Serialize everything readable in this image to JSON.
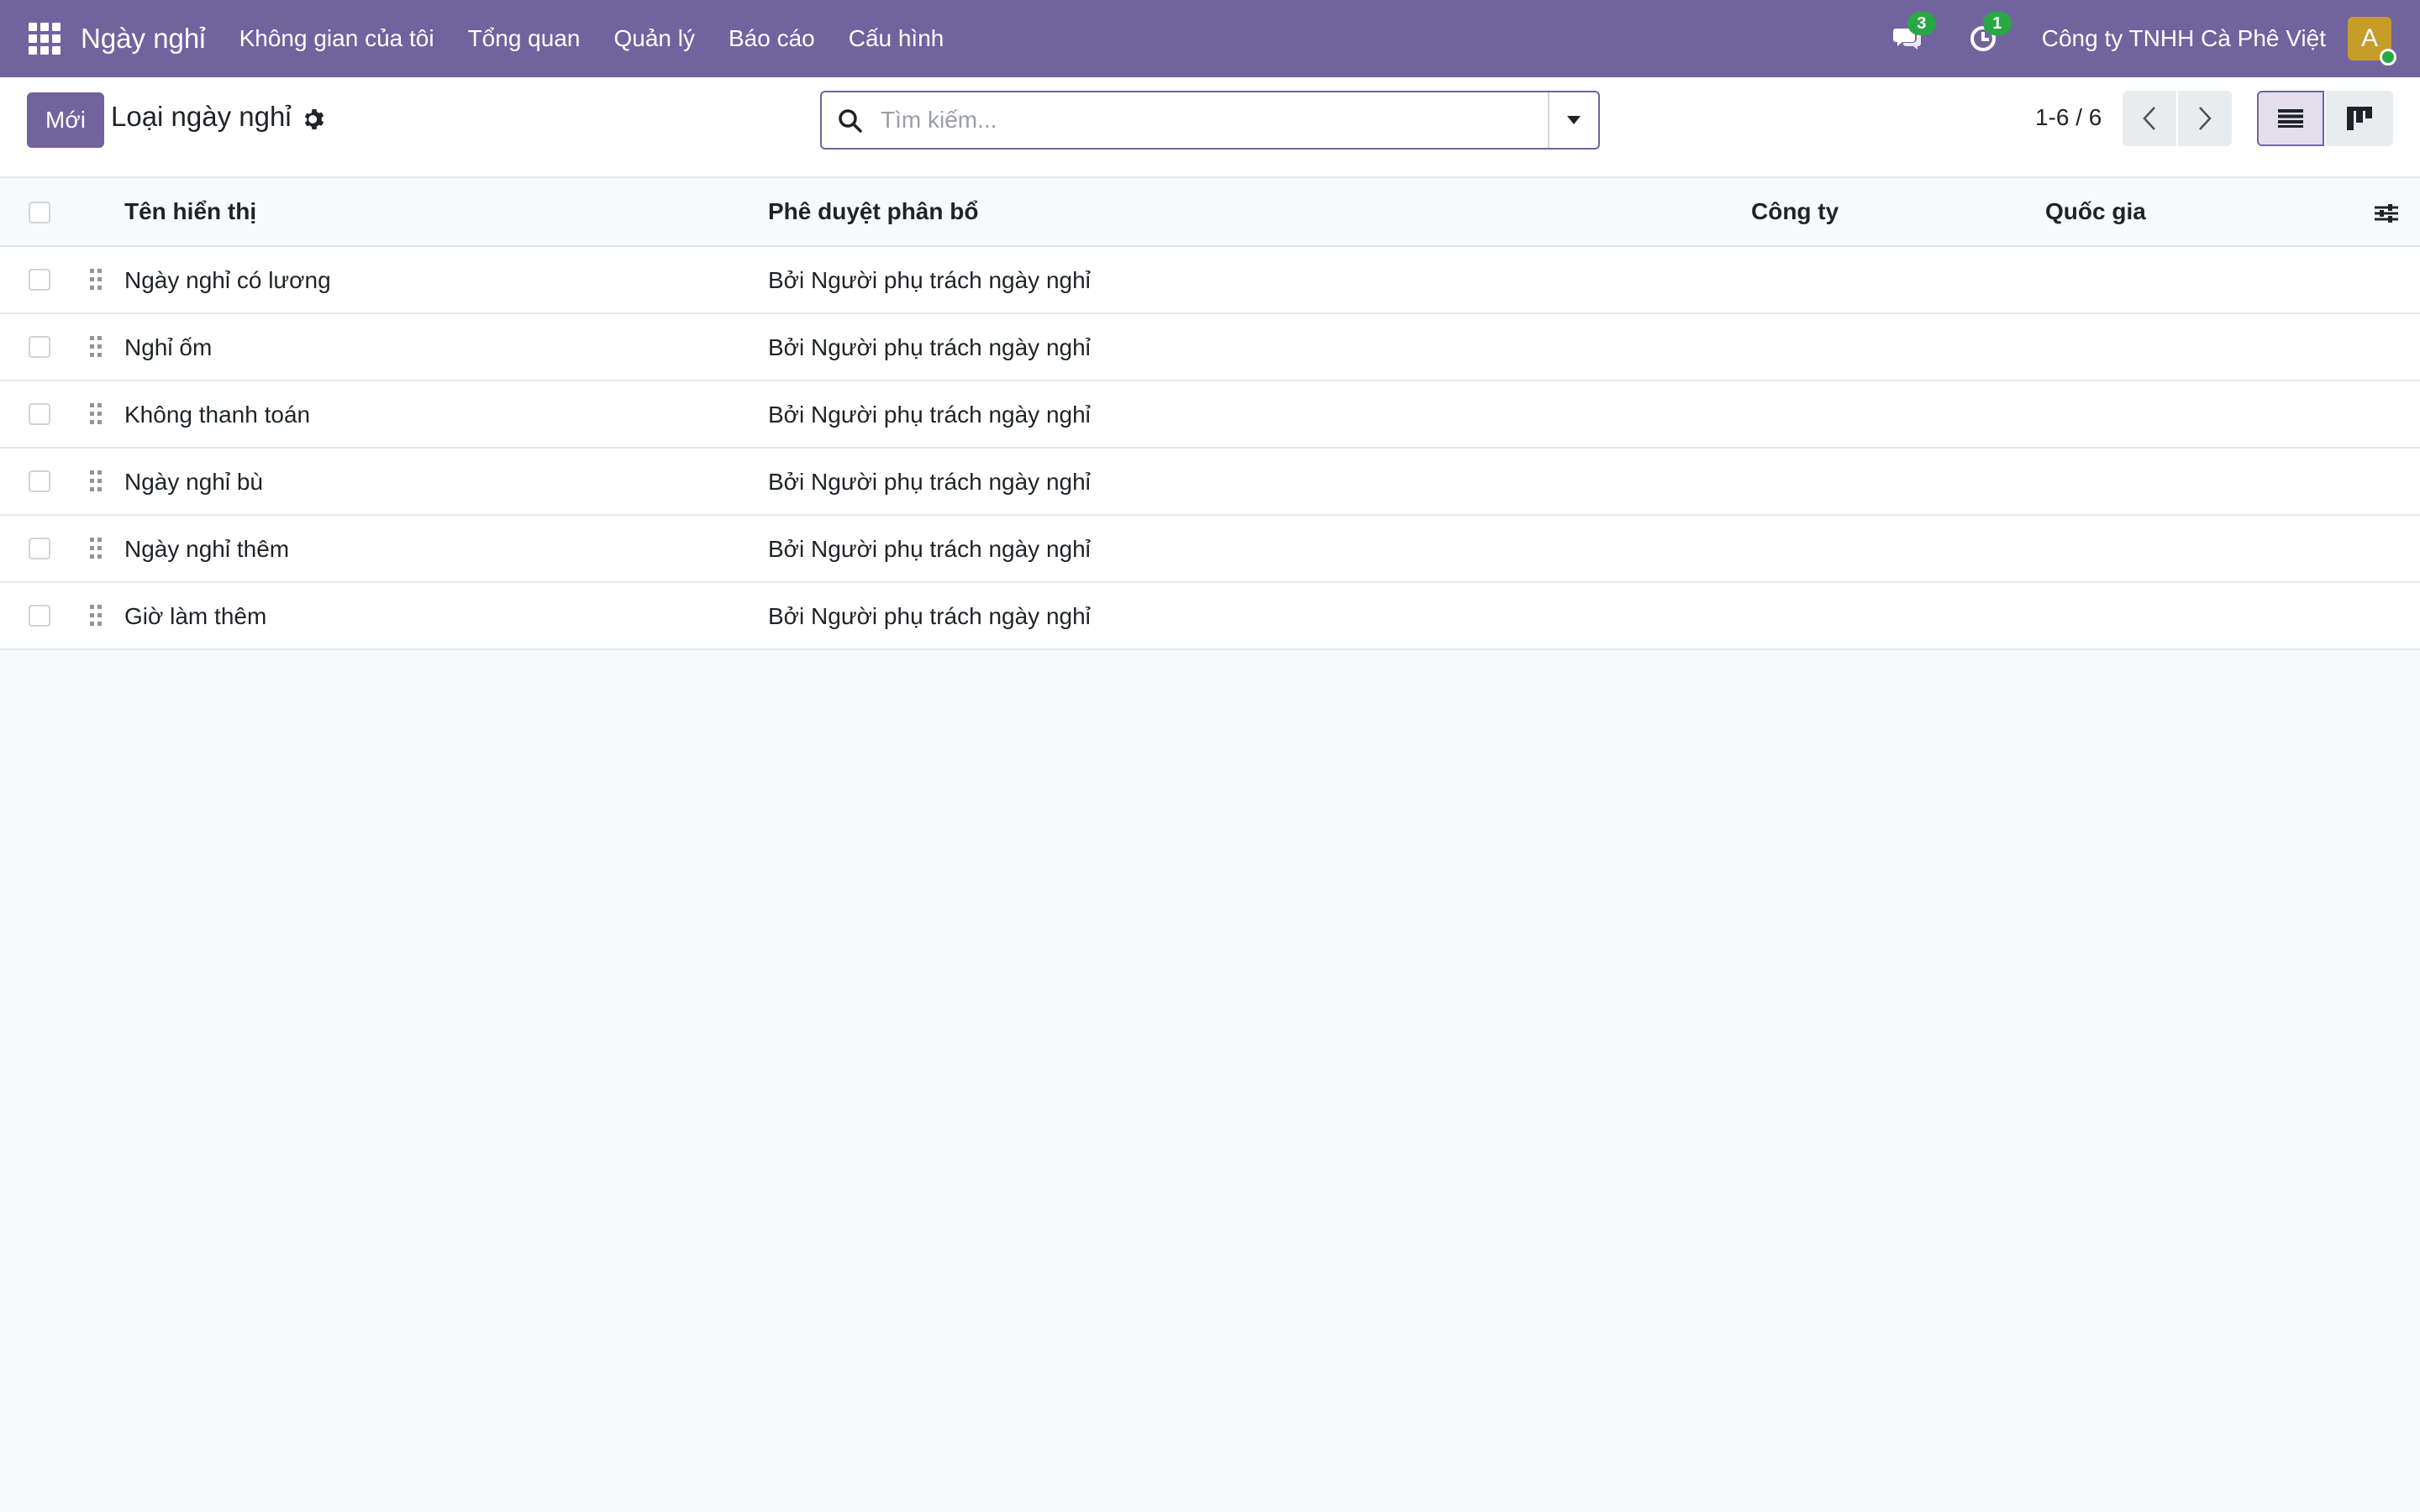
{
  "navbar": {
    "app_name": "Ngày nghỉ",
    "menu": [
      "Không gian của tôi",
      "Tổng quan",
      "Quản lý",
      "Báo cáo",
      "Cấu hình"
    ],
    "messages_count": "3",
    "activities_count": "1",
    "company": "Công ty TNHH Cà Phê Việt",
    "avatar_letter": "A"
  },
  "control_panel": {
    "new_button": "Mới",
    "title": "Loại ngày nghỉ",
    "search_placeholder": "Tìm kiếm...",
    "pager": "1-6 / 6"
  },
  "table": {
    "headers": {
      "name": "Tên hiển thị",
      "approval": "Phê duyệt phân bổ",
      "company": "Công ty",
      "country": "Quốc gia"
    },
    "rows": [
      {
        "name": "Ngày nghỉ có lương",
        "approval": "Bởi Người phụ trách ngày nghỉ",
        "company": "",
        "country": ""
      },
      {
        "name": "Nghỉ ốm",
        "approval": "Bởi Người phụ trách ngày nghỉ",
        "company": "",
        "country": ""
      },
      {
        "name": "Không thanh toán",
        "approval": "Bởi Người phụ trách ngày nghỉ",
        "company": "",
        "country": ""
      },
      {
        "name": "Ngày nghỉ bù",
        "approval": "Bởi Người phụ trách ngày nghỉ",
        "company": "",
        "country": ""
      },
      {
        "name": "Ngày nghỉ thêm",
        "approval": "Bởi Người phụ trách ngày nghỉ",
        "company": "",
        "country": ""
      },
      {
        "name": "Giờ làm thêm",
        "approval": "Bởi Người phụ trách ngày nghỉ",
        "company": "",
        "country": ""
      }
    ]
  },
  "colors": {
    "brand": "#71639e",
    "badge": "#28a745",
    "avatar": "#c69c2b"
  }
}
